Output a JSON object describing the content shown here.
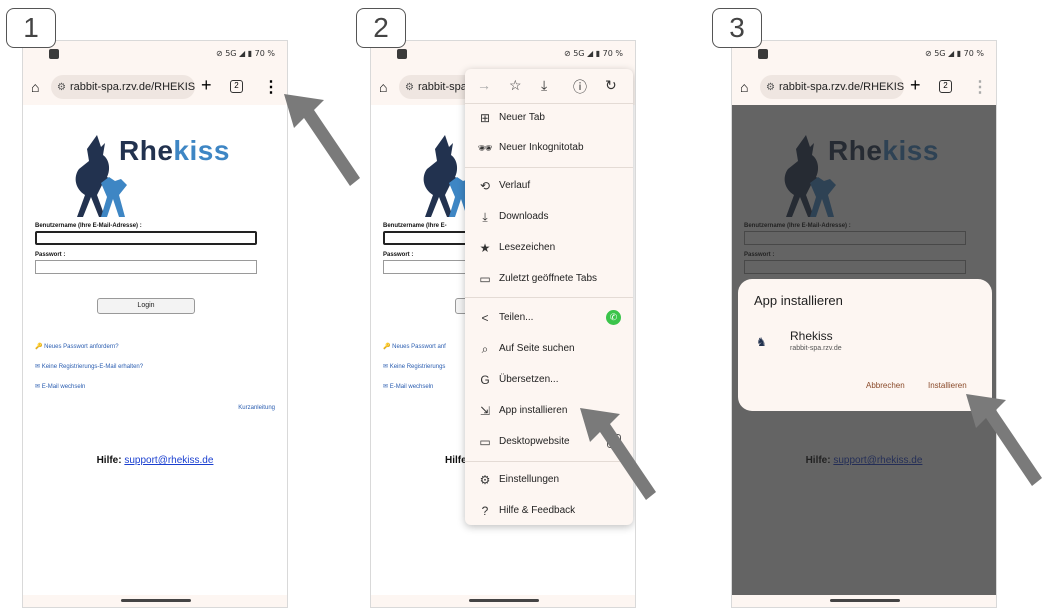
{
  "steps": [
    "1",
    "2",
    "3"
  ],
  "status": {
    "right": "⊘ 5G ◢ ▮ 70 %"
  },
  "browser": {
    "url": "rabbit-spa.rzv.de/RHEKIS",
    "url_short": "rabbit-spa",
    "tab_count": "2"
  },
  "login": {
    "logo_rhe": "Rhe",
    "logo_kiss": "kiss",
    "username_label": "Benutzername (Ihre E-Mail-Adresse) :",
    "username_label_short": "Benutzername (Ihre E-",
    "password_label": "Passwort :",
    "login_button": "Login",
    "link_password": "Neues Passwort anfordern?",
    "link_password_short": "Neues Passwort anf",
    "link_registration": "Keine Registrierungs-E-Mail erhalten?",
    "link_registration_short": "Keine Registrierungs",
    "link_email": "E-Mail wechseln",
    "link_quick": "Kurzanleitung",
    "help_label": "Hilfe:",
    "help_label_short": "Hilfe",
    "help_email": "support@rhekiss.de"
  },
  "menu": {
    "items": [
      {
        "icon": "⊞",
        "label": "Neuer Tab"
      },
      {
        "icon": "🕶",
        "label": "Neuer Inkognitotab"
      },
      {
        "icon": "⟲",
        "label": "Verlauf"
      },
      {
        "icon": "⤓",
        "label": "Downloads"
      },
      {
        "icon": "★",
        "label": "Lesezeichen"
      },
      {
        "icon": "▭",
        "label": "Zuletzt geöffnete Tabs"
      },
      {
        "icon": "<",
        "label": "Teilen..."
      },
      {
        "icon": "⌕",
        "label": "Auf Seite suchen"
      },
      {
        "icon": "G",
        "label": "Übersetzen..."
      },
      {
        "icon": "⇲",
        "label": "App installieren"
      },
      {
        "icon": "▭",
        "label": "Desktopwebsite"
      },
      {
        "icon": "⚙",
        "label": "Einstellungen"
      },
      {
        "icon": "?",
        "label": "Hilfe & Feedback"
      }
    ]
  },
  "dialog": {
    "title": "App installieren",
    "app_name": "Rhekiss",
    "app_url": "rabbit-spa.rzv.de",
    "cancel": "Abbrechen",
    "install": "Installieren"
  },
  "colors": {
    "accent_dark": "#22324f",
    "accent_blue": "#3e86c4",
    "link": "#2a5db0",
    "arrow": "#7a7a7a"
  }
}
